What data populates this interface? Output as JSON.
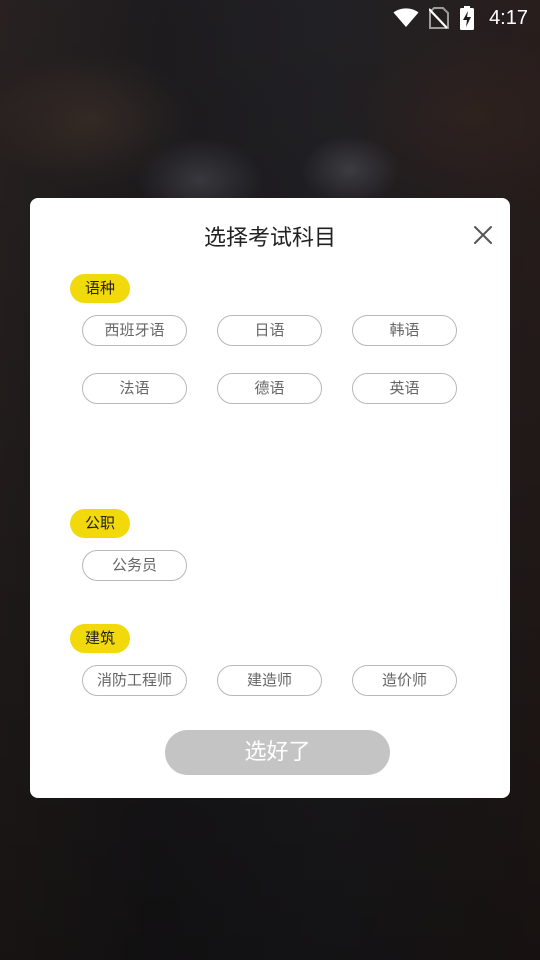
{
  "status_bar": {
    "time": "4:17",
    "icons": [
      "wifi-icon",
      "no-sim-icon",
      "battery-charging-icon"
    ]
  },
  "dialog": {
    "title": "选择考试科目",
    "close_icon": "close-icon",
    "sections": [
      {
        "tag": "语种",
        "options": [
          "西班牙语",
          "日语",
          "韩语",
          "法语",
          "德语",
          "英语"
        ]
      },
      {
        "tag": "公职",
        "options": [
          "公务员"
        ]
      },
      {
        "tag": "建筑",
        "options": [
          "消防工程师",
          "建造师",
          "造价师"
        ]
      }
    ],
    "confirm_label": "选好了"
  },
  "colors": {
    "tag_yellow": "#f2d90c",
    "confirm_disabled": "#c4c4c4",
    "chip_border": "#b8b8b8"
  }
}
